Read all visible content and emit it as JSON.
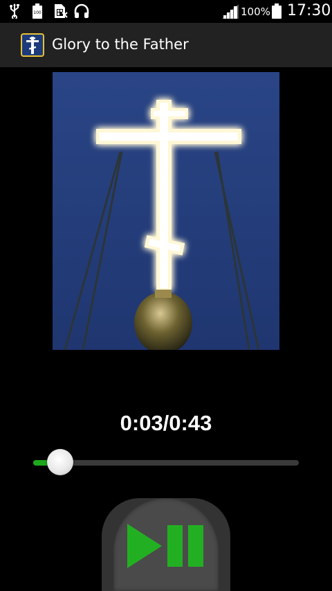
{
  "status_bar": {
    "battery_percent": "100%",
    "time": "17:30",
    "icons": [
      "usb-icon",
      "battery-saver-icon",
      "sim-card-icon",
      "headphones-icon",
      "signal-icon",
      "battery-icon"
    ]
  },
  "action_bar": {
    "title": "Glory to the Father",
    "icon": "orthodox-cross-app-icon"
  },
  "player": {
    "time_display": "0:03/0:43",
    "progress": 0.07,
    "button_icon": "play-pause-icon"
  },
  "colors": {
    "accent": "#1ea81e",
    "action_bar_bg": "#222222",
    "app_icon_border": "#e8c233",
    "sky": "#273f7a"
  }
}
